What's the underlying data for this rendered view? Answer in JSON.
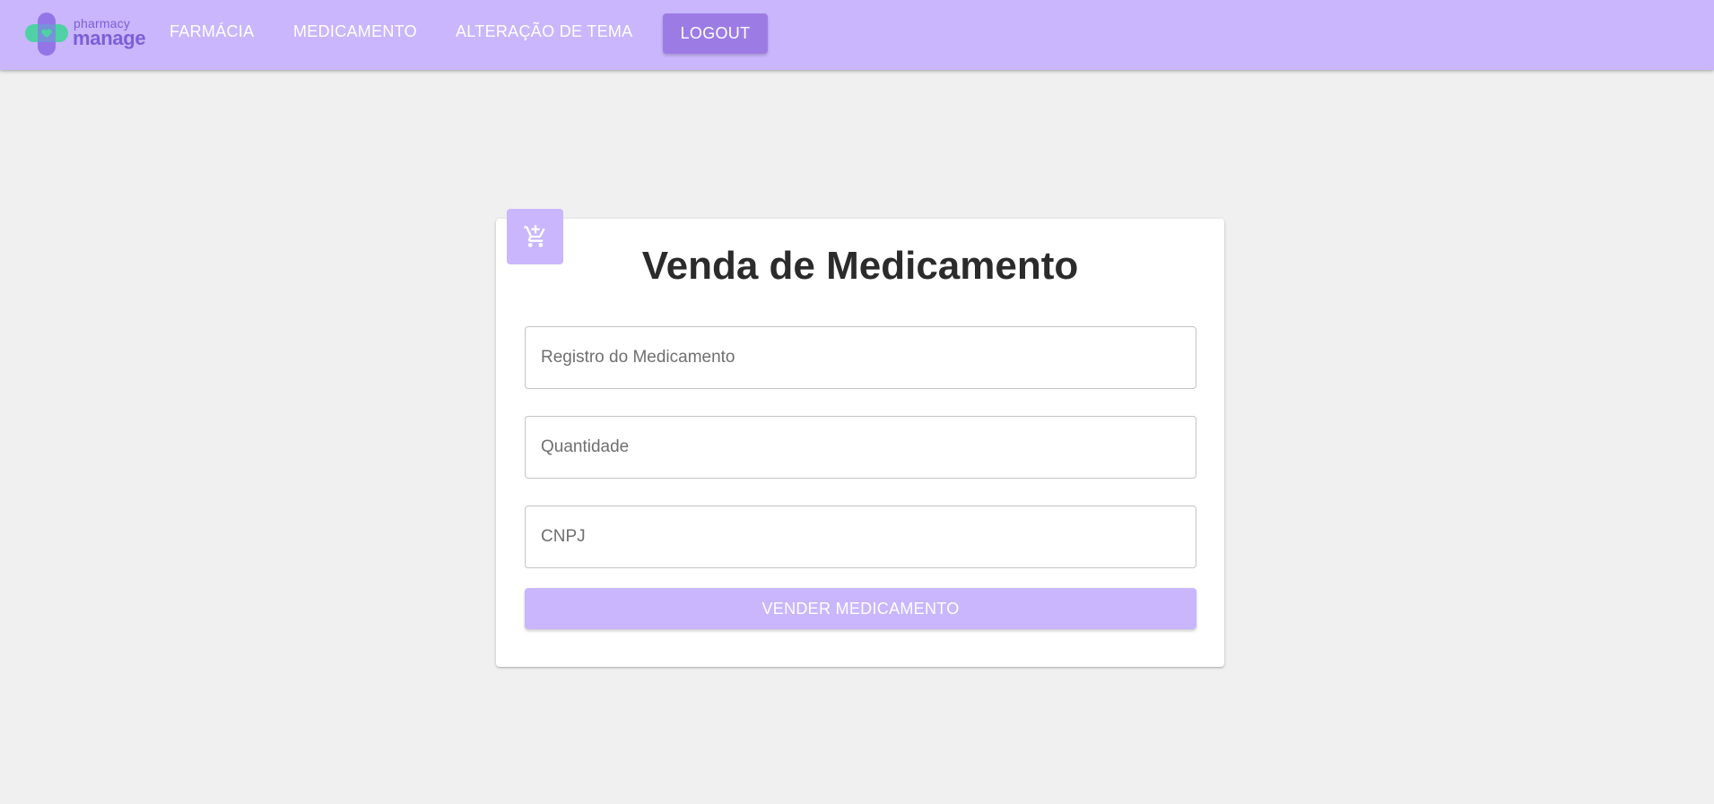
{
  "colors": {
    "primary": "#c9b6fc",
    "primary_dark": "#9c7ce4",
    "logo_text": "#7a5fd8",
    "logo_green": "#4fd1a5",
    "logo_purple": "#8e6ee6",
    "background": "#f0f0f0"
  },
  "header": {
    "logo": {
      "small": "pharmacy",
      "large": "manage",
      "icon": "pharmacy-cross-heart-icon"
    },
    "nav": [
      {
        "label": "FARMÁCIA"
      },
      {
        "label": "MEDICAMENTO"
      },
      {
        "label": "ALTERAÇÃO DE TEMA"
      }
    ],
    "logout_label": "LOGOUT"
  },
  "form": {
    "icon": "add-shopping-cart-icon",
    "title": "Venda de Medicamento",
    "fields": [
      {
        "placeholder": "Registro do Medicamento",
        "value": ""
      },
      {
        "placeholder": "Quantidade",
        "value": ""
      },
      {
        "placeholder": "CNPJ",
        "value": ""
      }
    ],
    "submit_label": "VENDER MEDICAMENTO"
  }
}
